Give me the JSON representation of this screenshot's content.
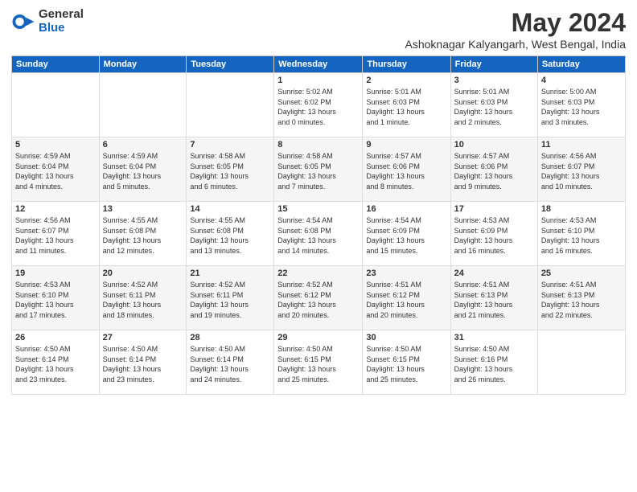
{
  "logo": {
    "general": "General",
    "blue": "Blue"
  },
  "title": {
    "month": "May 2024",
    "location": "Ashoknagar Kalyangarh, West Bengal, India"
  },
  "weekdays": [
    "Sunday",
    "Monday",
    "Tuesday",
    "Wednesday",
    "Thursday",
    "Friday",
    "Saturday"
  ],
  "weeks": [
    [
      {
        "day": "",
        "info": ""
      },
      {
        "day": "",
        "info": ""
      },
      {
        "day": "",
        "info": ""
      },
      {
        "day": "1",
        "info": "Sunrise: 5:02 AM\nSunset: 6:02 PM\nDaylight: 13 hours\nand 0 minutes."
      },
      {
        "day": "2",
        "info": "Sunrise: 5:01 AM\nSunset: 6:03 PM\nDaylight: 13 hours\nand 1 minute."
      },
      {
        "day": "3",
        "info": "Sunrise: 5:01 AM\nSunset: 6:03 PM\nDaylight: 13 hours\nand 2 minutes."
      },
      {
        "day": "4",
        "info": "Sunrise: 5:00 AM\nSunset: 6:03 PM\nDaylight: 13 hours\nand 3 minutes."
      }
    ],
    [
      {
        "day": "5",
        "info": "Sunrise: 4:59 AM\nSunset: 6:04 PM\nDaylight: 13 hours\nand 4 minutes."
      },
      {
        "day": "6",
        "info": "Sunrise: 4:59 AM\nSunset: 6:04 PM\nDaylight: 13 hours\nand 5 minutes."
      },
      {
        "day": "7",
        "info": "Sunrise: 4:58 AM\nSunset: 6:05 PM\nDaylight: 13 hours\nand 6 minutes."
      },
      {
        "day": "8",
        "info": "Sunrise: 4:58 AM\nSunset: 6:05 PM\nDaylight: 13 hours\nand 7 minutes."
      },
      {
        "day": "9",
        "info": "Sunrise: 4:57 AM\nSunset: 6:06 PM\nDaylight: 13 hours\nand 8 minutes."
      },
      {
        "day": "10",
        "info": "Sunrise: 4:57 AM\nSunset: 6:06 PM\nDaylight: 13 hours\nand 9 minutes."
      },
      {
        "day": "11",
        "info": "Sunrise: 4:56 AM\nSunset: 6:07 PM\nDaylight: 13 hours\nand 10 minutes."
      }
    ],
    [
      {
        "day": "12",
        "info": "Sunrise: 4:56 AM\nSunset: 6:07 PM\nDaylight: 13 hours\nand 11 minutes."
      },
      {
        "day": "13",
        "info": "Sunrise: 4:55 AM\nSunset: 6:08 PM\nDaylight: 13 hours\nand 12 minutes."
      },
      {
        "day": "14",
        "info": "Sunrise: 4:55 AM\nSunset: 6:08 PM\nDaylight: 13 hours\nand 13 minutes."
      },
      {
        "day": "15",
        "info": "Sunrise: 4:54 AM\nSunset: 6:08 PM\nDaylight: 13 hours\nand 14 minutes."
      },
      {
        "day": "16",
        "info": "Sunrise: 4:54 AM\nSunset: 6:09 PM\nDaylight: 13 hours\nand 15 minutes."
      },
      {
        "day": "17",
        "info": "Sunrise: 4:53 AM\nSunset: 6:09 PM\nDaylight: 13 hours\nand 16 minutes."
      },
      {
        "day": "18",
        "info": "Sunrise: 4:53 AM\nSunset: 6:10 PM\nDaylight: 13 hours\nand 16 minutes."
      }
    ],
    [
      {
        "day": "19",
        "info": "Sunrise: 4:53 AM\nSunset: 6:10 PM\nDaylight: 13 hours\nand 17 minutes."
      },
      {
        "day": "20",
        "info": "Sunrise: 4:52 AM\nSunset: 6:11 PM\nDaylight: 13 hours\nand 18 minutes."
      },
      {
        "day": "21",
        "info": "Sunrise: 4:52 AM\nSunset: 6:11 PM\nDaylight: 13 hours\nand 19 minutes."
      },
      {
        "day": "22",
        "info": "Sunrise: 4:52 AM\nSunset: 6:12 PM\nDaylight: 13 hours\nand 20 minutes."
      },
      {
        "day": "23",
        "info": "Sunrise: 4:51 AM\nSunset: 6:12 PM\nDaylight: 13 hours\nand 20 minutes."
      },
      {
        "day": "24",
        "info": "Sunrise: 4:51 AM\nSunset: 6:13 PM\nDaylight: 13 hours\nand 21 minutes."
      },
      {
        "day": "25",
        "info": "Sunrise: 4:51 AM\nSunset: 6:13 PM\nDaylight: 13 hours\nand 22 minutes."
      }
    ],
    [
      {
        "day": "26",
        "info": "Sunrise: 4:50 AM\nSunset: 6:14 PM\nDaylight: 13 hours\nand 23 minutes."
      },
      {
        "day": "27",
        "info": "Sunrise: 4:50 AM\nSunset: 6:14 PM\nDaylight: 13 hours\nand 23 minutes."
      },
      {
        "day": "28",
        "info": "Sunrise: 4:50 AM\nSunset: 6:14 PM\nDaylight: 13 hours\nand 24 minutes."
      },
      {
        "day": "29",
        "info": "Sunrise: 4:50 AM\nSunset: 6:15 PM\nDaylight: 13 hours\nand 25 minutes."
      },
      {
        "day": "30",
        "info": "Sunrise: 4:50 AM\nSunset: 6:15 PM\nDaylight: 13 hours\nand 25 minutes."
      },
      {
        "day": "31",
        "info": "Sunrise: 4:50 AM\nSunset: 6:16 PM\nDaylight: 13 hours\nand 26 minutes."
      },
      {
        "day": "",
        "info": ""
      }
    ]
  ]
}
